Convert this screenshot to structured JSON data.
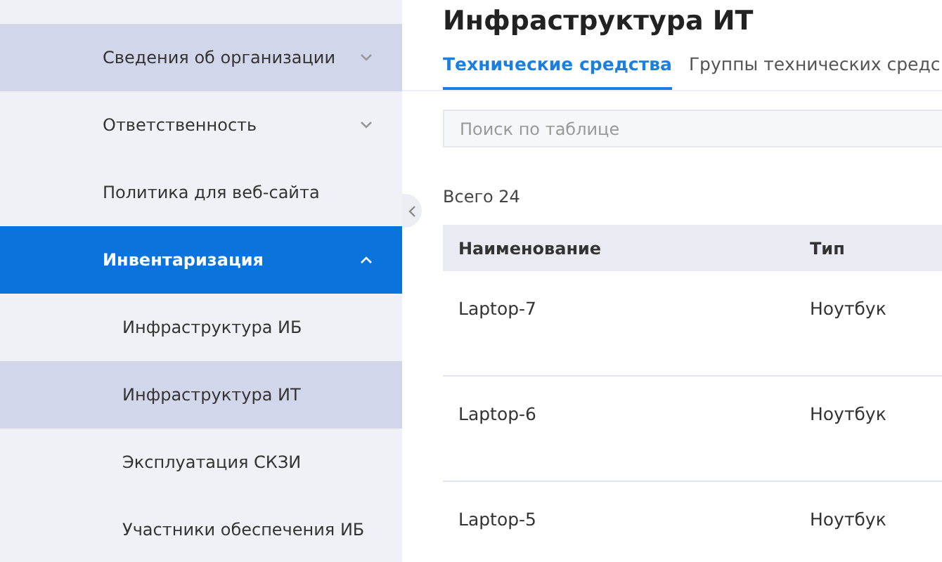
{
  "sidebar": {
    "items": [
      {
        "kind": "group",
        "label": "Сведения об организации",
        "selected": true,
        "active": false,
        "expanded": false
      },
      {
        "kind": "group",
        "label": "Ответственность",
        "selected": false,
        "active": false,
        "expanded": false
      },
      {
        "kind": "link",
        "label": "Политика для веб-сайта",
        "selected": false,
        "active": false
      },
      {
        "kind": "group",
        "label": "Инвентаризация",
        "active": true,
        "expanded": true,
        "children": [
          {
            "label": "Инфраструктура ИБ",
            "selected": false
          },
          {
            "label": "Инфраструктура ИТ",
            "selected": true
          },
          {
            "label": "Эксплуатация СКЗИ",
            "selected": false
          },
          {
            "label": "Участники обеспечения ИБ",
            "selected": false
          }
        ]
      }
    ]
  },
  "page": {
    "title": "Инфраструктура ИТ",
    "tabs": [
      {
        "label": "Технические средства",
        "selected": true
      },
      {
        "label": "Группы технических средс",
        "selected": false
      }
    ],
    "search": {
      "placeholder": "Поиск по таблице"
    },
    "total": "Всего 24",
    "table": {
      "columns": [
        "Наименование",
        "Тип"
      ],
      "rows": [
        [
          "Laptop-7",
          "Ноутбук"
        ],
        [
          "Laptop-6",
          "Ноутбук"
        ],
        [
          "Laptop-5",
          "Ноутбук"
        ]
      ]
    }
  }
}
